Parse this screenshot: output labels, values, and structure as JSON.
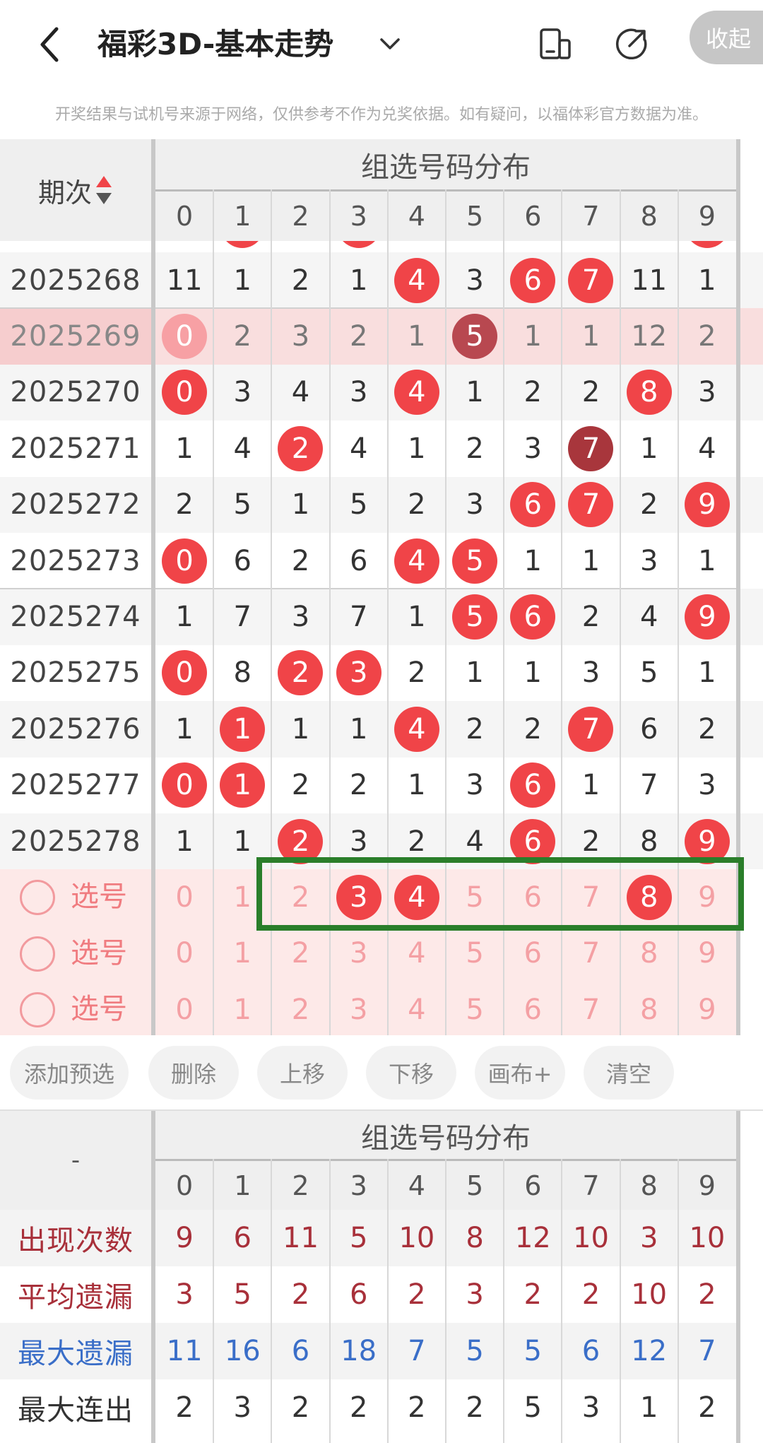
{
  "header": {
    "title": "福彩3D-基本走势",
    "icons": [
      "back-icon",
      "chevron-down-icon",
      "device-icon",
      "share-icon",
      "settings-icon"
    ]
  },
  "notice": "开奖结果与试机号来源于网络，仅供参考不作为兑奖依据。如有疑问，以福体彩官方数据为准。",
  "table": {
    "period_label": "期次",
    "group_title": "组选号码分布",
    "digits": [
      "0",
      "1",
      "2",
      "3",
      "4",
      "5",
      "6",
      "7",
      "8",
      "9"
    ],
    "rows": [
      {
        "period": "2025268",
        "highlight": false,
        "cells": [
          {
            "v": "11"
          },
          {
            "v": "1"
          },
          {
            "v": "2"
          },
          {
            "v": "1"
          },
          {
            "v": "4",
            "ball": "red"
          },
          {
            "v": "3"
          },
          {
            "v": "6",
            "ball": "red"
          },
          {
            "v": "7",
            "ball": "red"
          },
          {
            "v": "11"
          },
          {
            "v": "1"
          }
        ]
      },
      {
        "period": "2025269",
        "highlight": true,
        "cells": [
          {
            "v": "0",
            "ball": "pale"
          },
          {
            "v": "2"
          },
          {
            "v": "3"
          },
          {
            "v": "2"
          },
          {
            "v": "1"
          },
          {
            "v": "5",
            "ball": "dark"
          },
          {
            "v": "1"
          },
          {
            "v": "1"
          },
          {
            "v": "12"
          },
          {
            "v": "2"
          }
        ]
      },
      {
        "period": "2025270",
        "highlight": false,
        "cells": [
          {
            "v": "0",
            "ball": "red"
          },
          {
            "v": "3"
          },
          {
            "v": "4"
          },
          {
            "v": "3"
          },
          {
            "v": "4",
            "ball": "red"
          },
          {
            "v": "1"
          },
          {
            "v": "2"
          },
          {
            "v": "2"
          },
          {
            "v": "8",
            "ball": "red"
          },
          {
            "v": "3"
          }
        ]
      },
      {
        "period": "2025271",
        "highlight": false,
        "cells": [
          {
            "v": "1"
          },
          {
            "v": "4"
          },
          {
            "v": "2",
            "ball": "red"
          },
          {
            "v": "4"
          },
          {
            "v": "1"
          },
          {
            "v": "2"
          },
          {
            "v": "3"
          },
          {
            "v": "7",
            "ball": "brown"
          },
          {
            "v": "1"
          },
          {
            "v": "4"
          }
        ]
      },
      {
        "period": "2025272",
        "highlight": false,
        "cells": [
          {
            "v": "2"
          },
          {
            "v": "5"
          },
          {
            "v": "1"
          },
          {
            "v": "5"
          },
          {
            "v": "2"
          },
          {
            "v": "3"
          },
          {
            "v": "6",
            "ball": "red"
          },
          {
            "v": "7",
            "ball": "red"
          },
          {
            "v": "2"
          },
          {
            "v": "9",
            "ball": "red"
          }
        ]
      },
      {
        "period": "2025273",
        "highlight": false,
        "cells": [
          {
            "v": "0",
            "ball": "red"
          },
          {
            "v": "6"
          },
          {
            "v": "2"
          },
          {
            "v": "6"
          },
          {
            "v": "4",
            "ball": "red"
          },
          {
            "v": "5",
            "ball": "red"
          },
          {
            "v": "1"
          },
          {
            "v": "1"
          },
          {
            "v": "3"
          },
          {
            "v": "1"
          }
        ]
      },
      {
        "period": "2025274",
        "highlight": false,
        "cells": [
          {
            "v": "1"
          },
          {
            "v": "7"
          },
          {
            "v": "3"
          },
          {
            "v": "7"
          },
          {
            "v": "1"
          },
          {
            "v": "5",
            "ball": "red"
          },
          {
            "v": "6",
            "ball": "red"
          },
          {
            "v": "2"
          },
          {
            "v": "4"
          },
          {
            "v": "9",
            "ball": "red"
          }
        ]
      },
      {
        "period": "2025275",
        "highlight": false,
        "cells": [
          {
            "v": "0",
            "ball": "red"
          },
          {
            "v": "8"
          },
          {
            "v": "2",
            "ball": "red"
          },
          {
            "v": "3",
            "ball": "red"
          },
          {
            "v": "2"
          },
          {
            "v": "1"
          },
          {
            "v": "1"
          },
          {
            "v": "3"
          },
          {
            "v": "5"
          },
          {
            "v": "1"
          }
        ]
      },
      {
        "period": "2025276",
        "highlight": false,
        "cells": [
          {
            "v": "1"
          },
          {
            "v": "1",
            "ball": "red"
          },
          {
            "v": "1"
          },
          {
            "v": "1"
          },
          {
            "v": "4",
            "ball": "red"
          },
          {
            "v": "2"
          },
          {
            "v": "2"
          },
          {
            "v": "7",
            "ball": "red"
          },
          {
            "v": "6"
          },
          {
            "v": "2"
          }
        ]
      },
      {
        "period": "2025277",
        "highlight": false,
        "cells": [
          {
            "v": "0",
            "ball": "red"
          },
          {
            "v": "1",
            "ball": "red"
          },
          {
            "v": "2"
          },
          {
            "v": "2"
          },
          {
            "v": "1"
          },
          {
            "v": "3"
          },
          {
            "v": "6",
            "ball": "red"
          },
          {
            "v": "1"
          },
          {
            "v": "7"
          },
          {
            "v": "3"
          }
        ]
      },
      {
        "period": "2025278",
        "highlight": false,
        "cells": [
          {
            "v": "1"
          },
          {
            "v": "1"
          },
          {
            "v": "2",
            "ball": "red"
          },
          {
            "v": "3"
          },
          {
            "v": "2"
          },
          {
            "v": "4"
          },
          {
            "v": "6",
            "ball": "red"
          },
          {
            "v": "2"
          },
          {
            "v": "8"
          },
          {
            "v": "9",
            "ball": "red"
          }
        ]
      }
    ]
  },
  "select_rows": [
    {
      "label": "选号",
      "selected": [
        "3",
        "4",
        "8"
      ]
    },
    {
      "label": "选号",
      "selected": []
    },
    {
      "label": "选号",
      "selected": []
    }
  ],
  "toolbar": {
    "buttons": [
      "添加预选",
      "删除",
      "上移",
      "下移",
      "画布+",
      "清空"
    ],
    "collapse": "收起"
  },
  "stats": {
    "corner": "-",
    "group_title": "组选号码分布",
    "rows": [
      {
        "label": "出现次数",
        "color": "#a8303a",
        "values": [
          "9",
          "6",
          "11",
          "5",
          "10",
          "8",
          "12",
          "10",
          "3",
          "10"
        ]
      },
      {
        "label": "平均遗漏",
        "color": "#a8303a",
        "values": [
          "3",
          "5",
          "2",
          "6",
          "2",
          "3",
          "2",
          "2",
          "10",
          "2"
        ]
      },
      {
        "label": "最大遗漏",
        "color": "#3a6ec8",
        "values": [
          "11",
          "16",
          "6",
          "18",
          "7",
          "5",
          "5",
          "6",
          "12",
          "7"
        ]
      },
      {
        "label": "最大连出",
        "color": "#333333",
        "values": [
          "2",
          "3",
          "2",
          "2",
          "2",
          "2",
          "5",
          "3",
          "1",
          "2"
        ]
      }
    ]
  }
}
